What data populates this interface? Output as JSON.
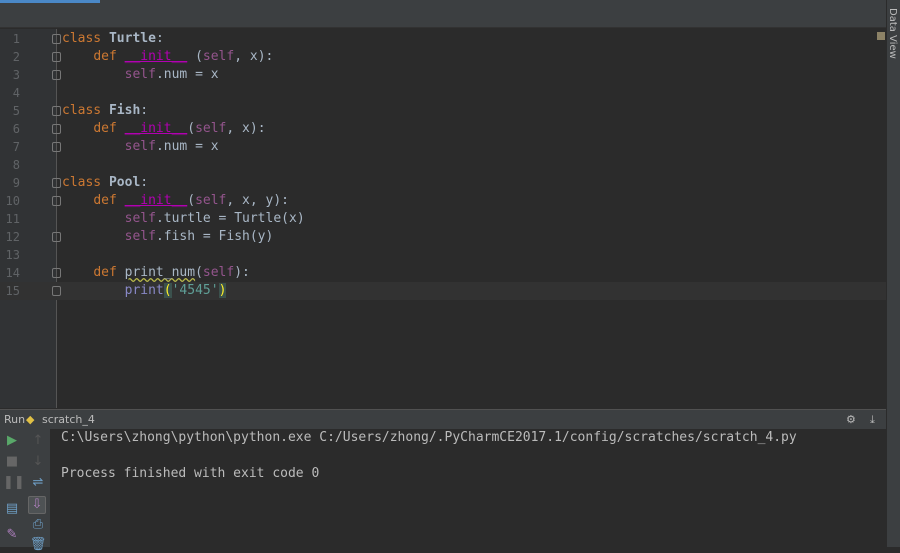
{
  "editor": {
    "lines": [
      {
        "n": "1",
        "tokens": [
          [
            "class ",
            "kw"
          ],
          [
            "Turtle",
            "cls"
          ],
          [
            ":",
            ""
          ]
        ],
        "fold": true
      },
      {
        "n": "2",
        "tokens": [
          [
            "    ",
            ""
          ],
          [
            "def ",
            "kw"
          ],
          [
            "__init__",
            "magic"
          ],
          [
            " (",
            ""
          ],
          [
            "self",
            "self"
          ],
          [
            ", x):",
            ""
          ]
        ],
        "fold": true
      },
      {
        "n": "3",
        "tokens": [
          [
            "        ",
            ""
          ],
          [
            "self",
            "self"
          ],
          [
            ".num = x",
            ""
          ]
        ],
        "fold": true
      },
      {
        "n": "4",
        "tokens": []
      },
      {
        "n": "5",
        "tokens": [
          [
            "class ",
            "kw"
          ],
          [
            "Fish",
            "cls"
          ],
          [
            ":",
            ""
          ]
        ],
        "fold": true
      },
      {
        "n": "6",
        "tokens": [
          [
            "    ",
            ""
          ],
          [
            "def ",
            "kw"
          ],
          [
            "__init__",
            "magic"
          ],
          [
            "(",
            ""
          ],
          [
            "self",
            "self"
          ],
          [
            ", x):",
            ""
          ]
        ],
        "fold": true
      },
      {
        "n": "7",
        "tokens": [
          [
            "        ",
            ""
          ],
          [
            "self",
            "self"
          ],
          [
            ".num = x",
            ""
          ]
        ],
        "fold": true
      },
      {
        "n": "8",
        "tokens": []
      },
      {
        "n": "9",
        "tokens": [
          [
            "class ",
            "kw"
          ],
          [
            "Pool",
            "cls"
          ],
          [
            ":",
            ""
          ]
        ],
        "fold": true
      },
      {
        "n": "10",
        "tokens": [
          [
            "    ",
            ""
          ],
          [
            "def ",
            "kw"
          ],
          [
            "__init__",
            "magic"
          ],
          [
            "(",
            ""
          ],
          [
            "self",
            "self"
          ],
          [
            ", x, y):",
            ""
          ]
        ],
        "fold": true
      },
      {
        "n": "11",
        "tokens": [
          [
            "        ",
            ""
          ],
          [
            "self",
            "self"
          ],
          [
            ".turtle = Turtle(x)",
            ""
          ]
        ]
      },
      {
        "n": "12",
        "tokens": [
          [
            "        ",
            ""
          ],
          [
            "self",
            "self"
          ],
          [
            ".fish = Fish(y)",
            ""
          ]
        ],
        "fold": true
      },
      {
        "n": "13",
        "tokens": []
      },
      {
        "n": "14",
        "tokens": [
          [
            "    ",
            ""
          ],
          [
            "def ",
            "kw"
          ],
          [
            "print_num",
            "warn"
          ],
          [
            "(",
            ""
          ],
          [
            "self",
            "self"
          ],
          [
            "):",
            ""
          ]
        ],
        "fold": true
      },
      {
        "n": "15",
        "tokens": [
          [
            "        ",
            ""
          ],
          [
            "print",
            "bi"
          ],
          [
            "(",
            "pb"
          ],
          [
            "'4545'",
            "str"
          ],
          [
            ")",
            "pb"
          ]
        ],
        "fold": true,
        "current": true
      }
    ]
  },
  "right_panel": {
    "label": "Data View"
  },
  "run": {
    "label": "Run",
    "config": "scratch_4",
    "output": [
      "C:\\Users\\zhong\\python\\python.exe C:/Users/zhong/.PyCharmCE2017.1/config/scratches/scratch_4.py",
      "",
      "Process finished with exit code 0"
    ]
  }
}
